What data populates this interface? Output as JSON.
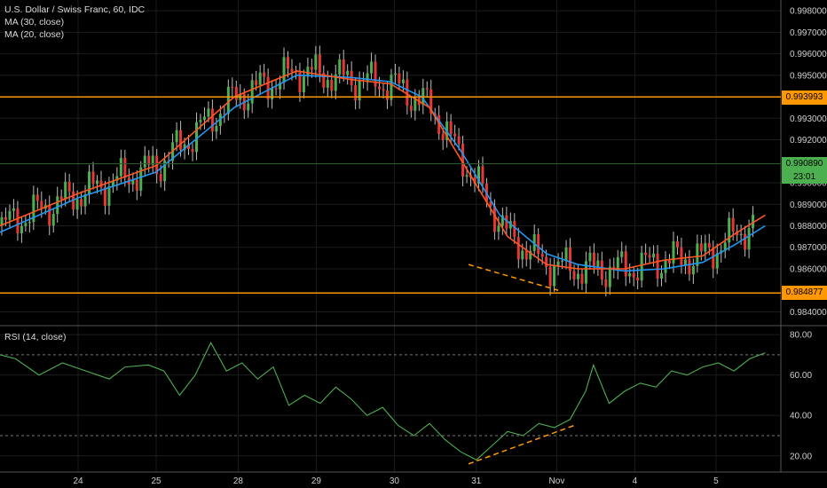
{
  "header": {
    "title": "U.S. Dollar / Swiss Franc, 60, IDC",
    "ma_slow": "MA (30, close)",
    "ma_fast": "MA (20, close)",
    "rsi": "RSI (14, close)"
  },
  "colors": {
    "background": "#000000",
    "grid": "#1c1c1c",
    "candle_up": "#4caf50",
    "candle_down": "#e53935",
    "wick": "#bdbdbd",
    "ma20": "#ff5722",
    "ma30": "#2196f3",
    "hline": "#ff9800",
    "rsi_line": "#4caf50",
    "axis_text": "#d0d0d0",
    "current_box": "#4caf50"
  },
  "price_boxes": {
    "upper_level": "0.993993",
    "current": "0.990890",
    "countdown": "23:01",
    "lower_level": "0.984877"
  },
  "chart_data": [
    {
      "type": "candlestick",
      "title": "U.S. Dollar / Swiss Franc, 60, IDC",
      "ylim": [
        0.9834,
        0.9985
      ],
      "y_ticks": [
        "0.998000",
        "0.997000",
        "0.996000",
        "0.995000",
        "0.993000",
        "0.992000",
        "0.990000",
        "0.989000",
        "0.988000",
        "0.987000",
        "0.986000",
        "0.984000"
      ],
      "x_ticks": [
        "24",
        "25",
        "28",
        "29",
        "30",
        "31",
        "Nov",
        "4",
        "5"
      ],
      "horizontal_levels": [
        0.993993,
        0.984877
      ],
      "last_price": 0.99089,
      "trendline": {
        "from": {
          "x": 0.6,
          "y": 0.9862
        },
        "to": {
          "x": 0.715,
          "y": 0.985
        }
      },
      "series": [
        {
          "name": "MA (30, close)",
          "points": [
            [
              0,
              0.9877
            ],
            [
              0.1,
              0.9893
            ],
            [
              0.2,
              0.9905
            ],
            [
              0.3,
              0.9935
            ],
            [
              0.38,
              0.995
            ],
            [
              0.45,
              0.9949
            ],
            [
              0.5,
              0.9947
            ],
            [
              0.54,
              0.994
            ],
            [
              0.59,
              0.9915
            ],
            [
              0.64,
              0.9885
            ],
            [
              0.7,
              0.9867
            ],
            [
              0.74,
              0.9862
            ],
            [
              0.8,
              0.9859
            ],
            [
              0.85,
              0.986
            ],
            [
              0.9,
              0.9863
            ],
            [
              0.94,
              0.9871
            ],
            [
              0.98,
              0.988
            ]
          ]
        },
        {
          "name": "MA (20, close)",
          "points": [
            [
              0,
              0.988
            ],
            [
              0.1,
              0.9895
            ],
            [
              0.2,
              0.9908
            ],
            [
              0.3,
              0.994
            ],
            [
              0.38,
              0.9952
            ],
            [
              0.45,
              0.9948
            ],
            [
              0.5,
              0.9946
            ],
            [
              0.55,
              0.9935
            ],
            [
              0.6,
              0.9905
            ],
            [
              0.65,
              0.9875
            ],
            [
              0.7,
              0.9862
            ],
            [
              0.74,
              0.986
            ],
            [
              0.8,
              0.986
            ],
            [
              0.85,
              0.9864
            ],
            [
              0.9,
              0.9866
            ],
            [
              0.94,
              0.9876
            ],
            [
              0.98,
              0.9885
            ]
          ]
        }
      ]
    },
    {
      "type": "line",
      "title": "RSI (14, close)",
      "ylim": [
        12,
        84
      ],
      "y_ticks": [
        "80.00",
        "60.00",
        "40.00",
        "20.00"
      ],
      "levels": [
        70,
        30
      ],
      "trendline": {
        "from": {
          "x": 0.6,
          "y": 16
        },
        "to": {
          "x": 0.735,
          "y": 35
        }
      },
      "series": [
        {
          "name": "RSI (14, close)",
          "points": [
            [
              0,
              70
            ],
            [
              0.02,
              68
            ],
            [
              0.05,
              60
            ],
            [
              0.08,
              66
            ],
            [
              0.11,
              62
            ],
            [
              0.14,
              58
            ],
            [
              0.16,
              64
            ],
            [
              0.19,
              65
            ],
            [
              0.21,
              62
            ],
            [
              0.23,
              50
            ],
            [
              0.25,
              60
            ],
            [
              0.27,
              76
            ],
            [
              0.29,
              62
            ],
            [
              0.31,
              66
            ],
            [
              0.33,
              58
            ],
            [
              0.35,
              64
            ],
            [
              0.37,
              45
            ],
            [
              0.39,
              50
            ],
            [
              0.41,
              46
            ],
            [
              0.43,
              54
            ],
            [
              0.45,
              48
            ],
            [
              0.47,
              40
            ],
            [
              0.49,
              44
            ],
            [
              0.51,
              35
            ],
            [
              0.53,
              30
            ],
            [
              0.55,
              36
            ],
            [
              0.57,
              28
            ],
            [
              0.59,
              22
            ],
            [
              0.61,
              18
            ],
            [
              0.63,
              25
            ],
            [
              0.65,
              32
            ],
            [
              0.67,
              30
            ],
            [
              0.69,
              36
            ],
            [
              0.71,
              34
            ],
            [
              0.73,
              38
            ],
            [
              0.75,
              52
            ],
            [
              0.76,
              65
            ],
            [
              0.78,
              46
            ],
            [
              0.8,
              52
            ],
            [
              0.82,
              56
            ],
            [
              0.84,
              54
            ],
            [
              0.86,
              62
            ],
            [
              0.88,
              60
            ],
            [
              0.9,
              64
            ],
            [
              0.92,
              66
            ],
            [
              0.94,
              62
            ],
            [
              0.96,
              68
            ],
            [
              0.98,
              71
            ]
          ]
        }
      ]
    }
  ]
}
